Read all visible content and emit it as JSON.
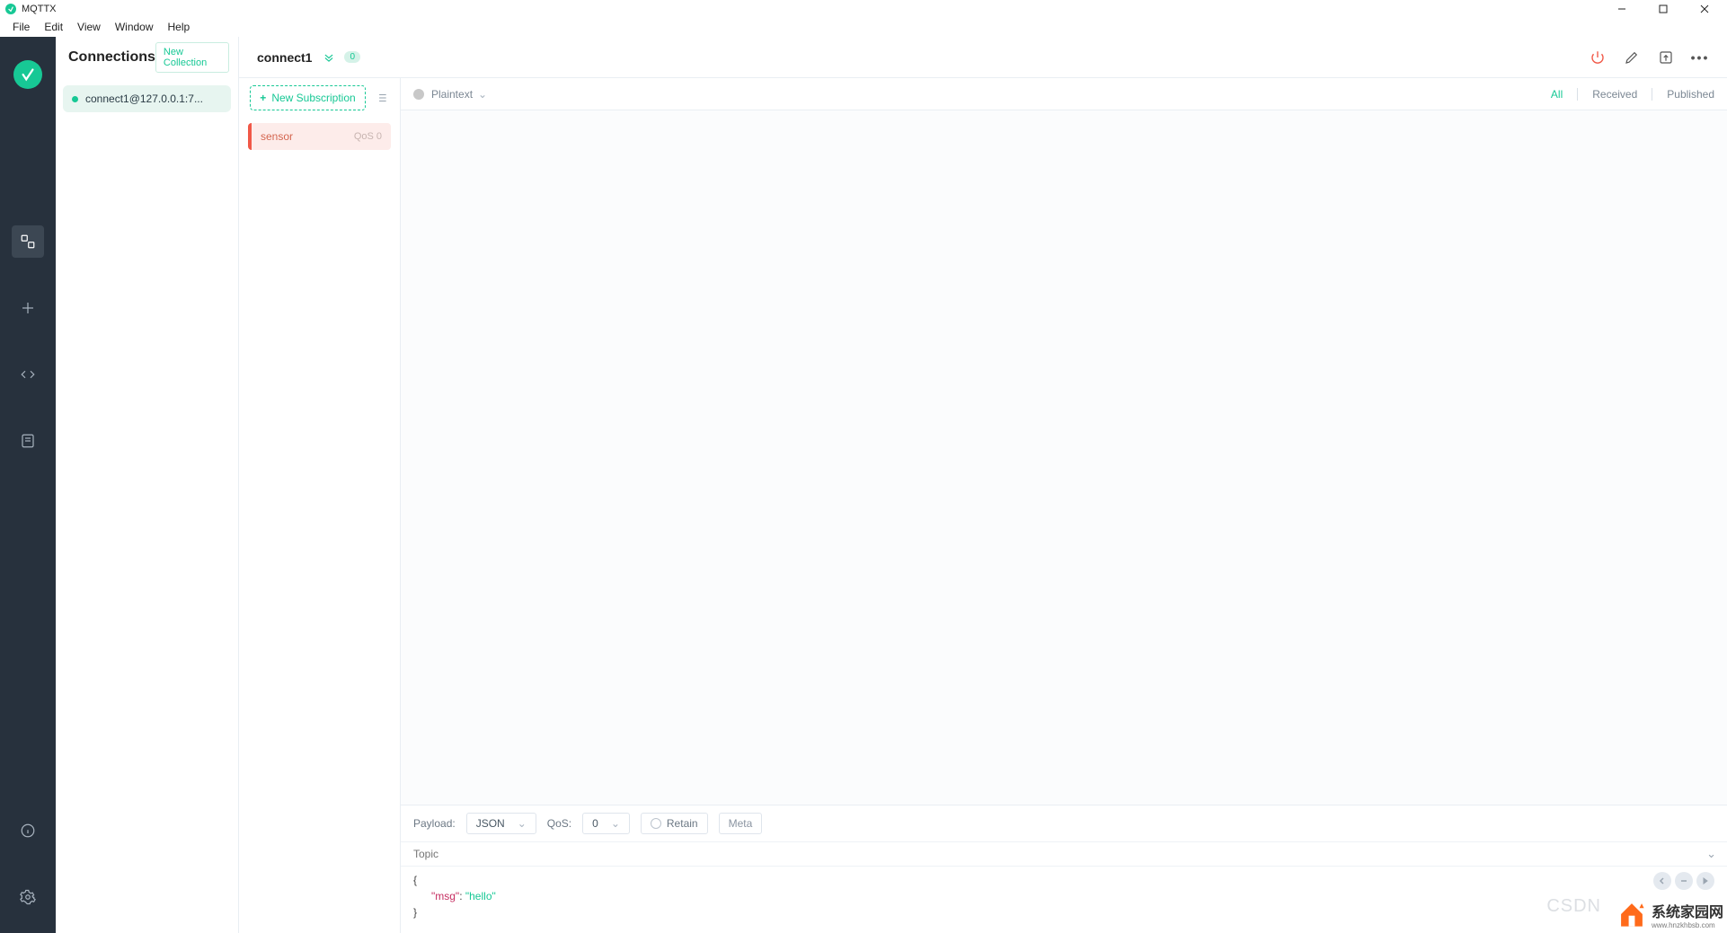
{
  "app_title": "MQTTX",
  "menu": {
    "file": "File",
    "edit": "Edit",
    "view": "View",
    "window": "Window",
    "help": "Help"
  },
  "connections_panel": {
    "title": "Connections",
    "new_collection": "New Collection",
    "items": [
      {
        "label": "connect1@127.0.0.1:7..."
      }
    ]
  },
  "subscriptions": {
    "new_sub": "New Subscription",
    "items": [
      {
        "topic": "sensor",
        "qos": "QoS 0"
      }
    ]
  },
  "main_header": {
    "title": "connect1",
    "badge": "0"
  },
  "message_toolbar": {
    "mode": "Plaintext",
    "tabs": {
      "all": "All",
      "received": "Received",
      "published": "Published"
    }
  },
  "publish": {
    "payload_label": "Payload:",
    "payload_type": "JSON",
    "qos_label": "QoS:",
    "qos_value": "0",
    "retain_label": "Retain",
    "meta_label": "Meta",
    "topic_placeholder": "Topic",
    "payload_key": "\"msg\"",
    "payload_colon": ": ",
    "payload_value": "\"hello\""
  },
  "watermarks": {
    "csdn": "CSDN",
    "brand_cn": "系统家园网",
    "brand_url": "www.hnzkhbsb.com"
  }
}
